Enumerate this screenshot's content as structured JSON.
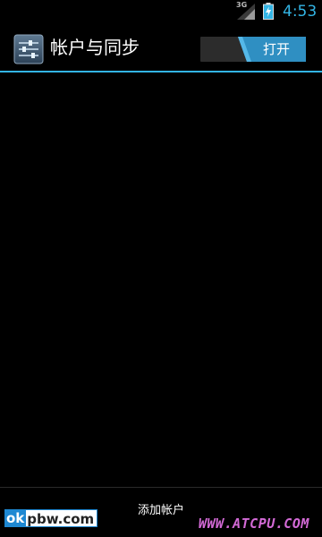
{
  "status_bar": {
    "network_type": "3G",
    "time": "4:53",
    "icons": [
      "signal-icon",
      "battery-charging-icon"
    ]
  },
  "action_bar": {
    "title": "帐户与同步",
    "icon": "settings-sliders-icon",
    "master_switch": {
      "label": "打开",
      "state": "on"
    }
  },
  "footer": {
    "add_account_label": "添加帐户"
  },
  "watermarks": {
    "left_badge": "ok",
    "left_text": "pbw.com",
    "right_text": "WWW.ATCPU.COM"
  },
  "colors": {
    "accent": "#33b5e5",
    "background": "#000000",
    "switch_track": "#2c2c2c",
    "watermark_pink": "#d36ad6",
    "watermark_blue": "#1e88d2"
  }
}
